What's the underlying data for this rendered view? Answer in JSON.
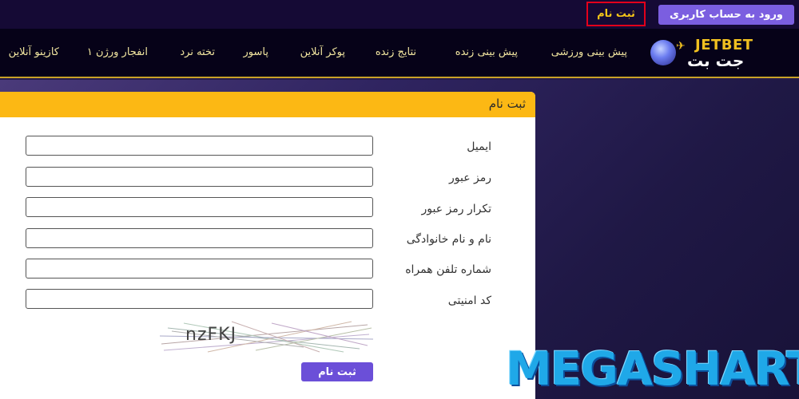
{
  "topbar": {
    "login_label": "ورود به حساب کاربری",
    "register_label": "ثبت نام"
  },
  "logo": {
    "latin": "JETBET",
    "persian": "جت بت"
  },
  "nav": {
    "items": [
      "پیش بینی ورزشی",
      "پیش بینی زنده",
      "نتایج زنده",
      "پوکر آنلاین",
      "پاسور",
      "تخته نرد",
      "انفجار ورژن ۱",
      "کازینو آنلاین"
    ]
  },
  "form": {
    "title": "ثبت نام",
    "fields": [
      {
        "label": "ایمیل",
        "value": ""
      },
      {
        "label": "رمز عبور",
        "value": ""
      },
      {
        "label": "تکرار رمز عبور",
        "value": ""
      },
      {
        "label": "نام و نام خانوادگی",
        "value": ""
      },
      {
        "label": "شماره تلفن همراه",
        "value": ""
      },
      {
        "label": "کد امنیتی",
        "value": ""
      }
    ],
    "captcha_text": "nzFKJ",
    "submit_label": "ثبت نام"
  },
  "watermark": {
    "text": "MEGASHART"
  },
  "colors": {
    "accent_yellow": "#fcb814",
    "button_purple": "#6b4fd8",
    "nav_bg": "#060218",
    "highlight_red": "#e3001b"
  }
}
